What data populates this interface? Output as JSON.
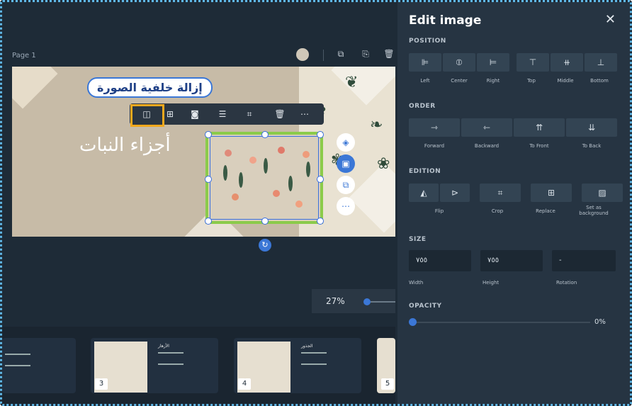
{
  "canvas": {
    "page_label": "Page 1",
    "slide_title_arabic": "أجزاء النبات",
    "callout_arabic": "إزالة خلفية الصورة",
    "zoom_value": "27%"
  },
  "thumbnails": [
    {
      "number": "3",
      "title": "الأزهار"
    },
    {
      "number": "4",
      "title": "الجذور"
    },
    {
      "number": "5",
      "title": ""
    }
  ],
  "panel": {
    "title": "Edit image",
    "close_icon": "close-icon",
    "position": {
      "heading": "POSITION",
      "buttons": [
        {
          "icon": "align-left-icon",
          "label": "Left"
        },
        {
          "icon": "align-center-icon",
          "label": "Center"
        },
        {
          "icon": "align-right-icon",
          "label": "Right"
        },
        {
          "icon": "align-top-icon",
          "label": "Top"
        },
        {
          "icon": "align-middle-icon",
          "label": "Middle"
        },
        {
          "icon": "align-bottom-icon",
          "label": "Bottom"
        }
      ]
    },
    "order": {
      "heading": "ORDER",
      "buttons": [
        {
          "icon": "forward-icon",
          "label": "Forward"
        },
        {
          "icon": "backward-icon",
          "label": "Backward"
        },
        {
          "icon": "to-front-icon",
          "label": "To Front"
        },
        {
          "icon": "to-back-icon",
          "label": "To Back"
        }
      ]
    },
    "edition": {
      "heading": "EDITION",
      "buttons": [
        {
          "icon": "flip-icon",
          "label": "Flip"
        },
        {
          "icon": "crop-icon",
          "label": "Crop"
        },
        {
          "icon": "replace-icon",
          "label": "Replace"
        },
        {
          "icon": "set-background-icon",
          "label": "Set as background"
        }
      ]
    },
    "size": {
      "heading": "SIZE",
      "width_value": "٧٥٥",
      "height_value": "٧٥٥",
      "rotation_value": "-",
      "width_label": "Width",
      "height_label": "Height",
      "rotation_label": "Rotation"
    },
    "opacity": {
      "heading": "OPACITY",
      "value": "0%"
    }
  },
  "colors": {
    "accent": "#3b77d6",
    "highlight": "#f2a81d",
    "selection": "#8bcb4a"
  }
}
